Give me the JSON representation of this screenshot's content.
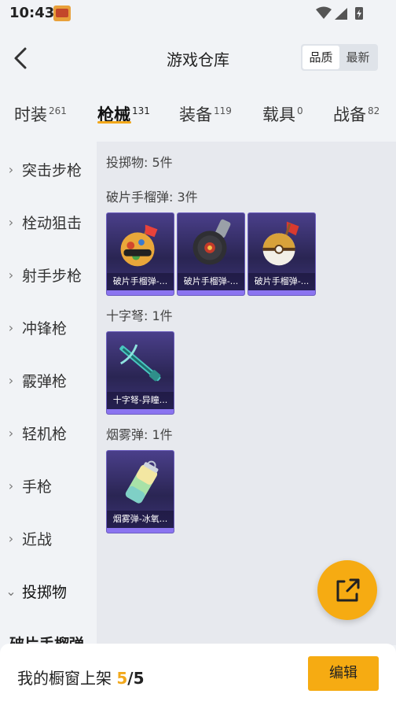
{
  "status_bar": {
    "time": "10:43"
  },
  "header": {
    "title": "游戏仓库",
    "sort_options": [
      "品质",
      "最新"
    ],
    "active_sort": "品质"
  },
  "tabs": [
    {
      "label": "时装",
      "count": "261"
    },
    {
      "label": "枪械",
      "count": "131"
    },
    {
      "label": "装备",
      "count": "119"
    },
    {
      "label": "载具",
      "count": "0"
    },
    {
      "label": "战备",
      "count": "82"
    }
  ],
  "active_tab": "枪械",
  "sidebar": {
    "items": [
      "突击步枪",
      "栓动狙击",
      "射手步枪",
      "冲锋枪",
      "霰弹枪",
      "轻机枪",
      "手枪",
      "近战",
      "投掷物"
    ],
    "active": "投掷物"
  },
  "content": {
    "section_total": "投掷物: 5件",
    "groups": [
      {
        "title": "破片手榴弹: 3件",
        "items": [
          {
            "name": "破片手榴弹-...",
            "icon": "grenade-skin-icon"
          },
          {
            "name": "破片手榴弹-...",
            "icon": "grenade-skin-icon"
          },
          {
            "name": "破片手榴弹-...",
            "icon": "grenade-skin-icon"
          }
        ]
      },
      {
        "title": "十字弩: 1件",
        "items": [
          {
            "name": "十字弩-异瞳...",
            "icon": "crossbow-skin-icon"
          }
        ]
      },
      {
        "title": "烟雾弹: 1件",
        "items": [
          {
            "name": "烟雾弹-冰氧...",
            "icon": "smoke-grenade-skin-icon"
          }
        ]
      }
    ],
    "next_section_peek": "破片手榴弹"
  },
  "fab": {
    "icon": "share-external-icon"
  },
  "bottom_bar": {
    "label": "我的橱窗上架",
    "count": "5",
    "total": "/5",
    "edit_label": "编辑"
  },
  "colors": {
    "accent": "#f6ab12",
    "card_bg": "#2a2553",
    "card_bar": "#8b74f0"
  }
}
